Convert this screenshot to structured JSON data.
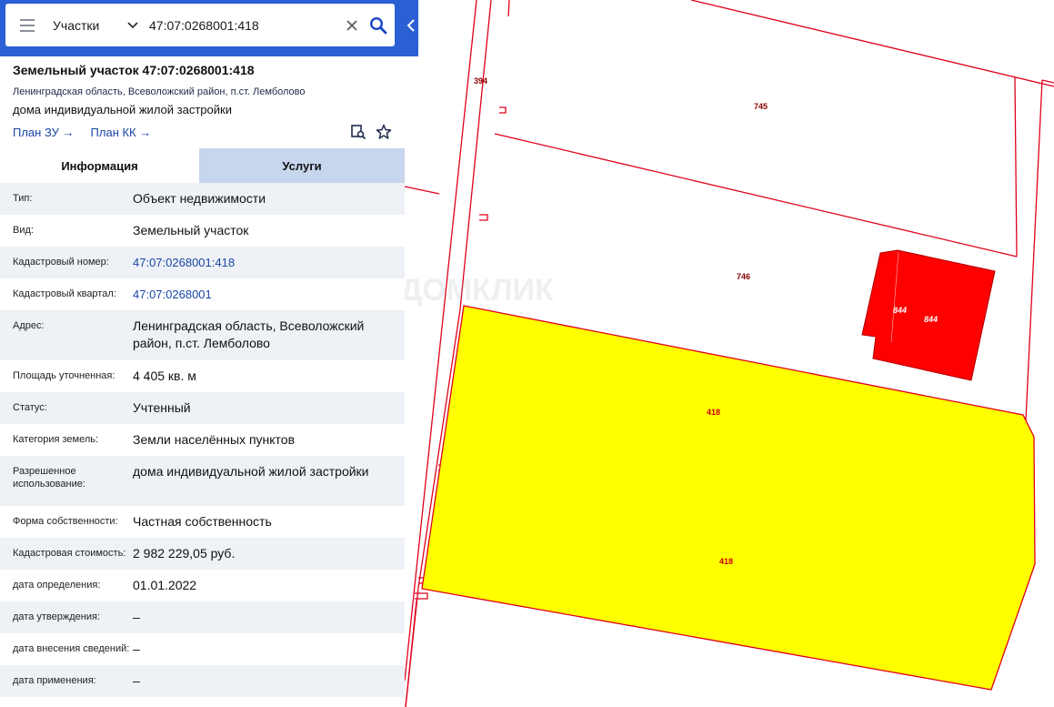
{
  "search": {
    "category": "Участки",
    "query": "47:07:0268001:418"
  },
  "card": {
    "title": "Земельный участок 47:07:0268001:418",
    "address": "Ленинградская область, Всеволожский район, п.ст. Лемболово",
    "use": "дома индивидуальной жилой застройки",
    "link_plan_zu": "План ЗУ →",
    "link_plan_kk": "План КК →"
  },
  "tabs": [
    {
      "label": "Информация",
      "active": true
    },
    {
      "label": "Услуги",
      "active": false
    }
  ],
  "info_rows": [
    {
      "label": "Тип:",
      "value": "Объект недвижимости"
    },
    {
      "label": "Вид:",
      "value": "Земельный участок"
    },
    {
      "label": "Кадастровый номер:",
      "value": "47:07:0268001:418",
      "link": true
    },
    {
      "label": "Кадастровый квартал:",
      "value": "47:07:0268001",
      "link": true
    },
    {
      "label": "Адрес:",
      "value": "Ленинградская область, Всеволожский район, п.ст. Лемболово"
    },
    {
      "label": "Площадь уточненная:",
      "value": "4 405 кв. м"
    },
    {
      "label": "Статус:",
      "value": "Учтенный"
    },
    {
      "label": "Категория земель:",
      "value": "Земли населённых пунктов"
    },
    {
      "label": "Разрешенное использование:",
      "value": "дома индивидуальной жилой застройки"
    },
    {
      "label": "Форма собственности:",
      "value": "Частная собственность"
    },
    {
      "label": "Кадастровая стоимость:",
      "value": "2 982 229,05 руб."
    },
    {
      "label": "дата определения:",
      "value": "01.01.2022"
    },
    {
      "label": "дата утверждения:",
      "value": "–"
    },
    {
      "label": "дата внесения сведений:",
      "value": "–"
    },
    {
      "label": "дата применения:",
      "value": "–"
    }
  ],
  "map": {
    "parcel_labels": [
      "394",
      "745",
      "746",
      "844",
      "844",
      "418",
      "418"
    ],
    "watermark": "ДОМКЛИК",
    "colors": {
      "boundary": "#e0001b",
      "selected_fill": "#ffff00",
      "building_fill": "#ff0000",
      "accent": "#2b5fd4"
    }
  }
}
